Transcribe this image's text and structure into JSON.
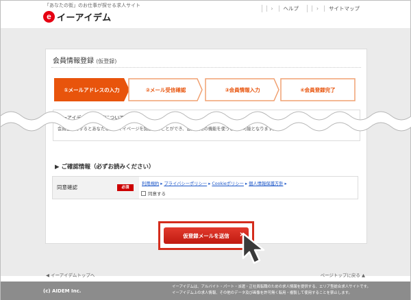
{
  "header": {
    "tagline": "「あなたの街」のお仕事が探せる求人サイト",
    "logo_mark": "e",
    "logo_text": "イーアイデム",
    "util_links": [
      {
        "label": "ヘルプ"
      },
      {
        "label": "サイトマップ"
      }
    ]
  },
  "panel": {
    "title": "会員情報登録",
    "subtitle": "(仮登録)"
  },
  "steps": [
    {
      "label": "①メールアドレスの入力",
      "active": true
    },
    {
      "label": "②メール受信確認",
      "active": false
    },
    {
      "label": "③会員情報入力",
      "active": false
    },
    {
      "label": "④会員登録完了",
      "active": false
    }
  ],
  "info": {
    "title": "イーアイデム会員登録について",
    "text": "会員登録をするとあなた専用のマイページを開設することができ、会員専用の機能を使うことが可能となります。"
  },
  "notice": {
    "title": "▶ ご確認情報（必ずお読みください）"
  },
  "agree": {
    "label": "同意確認",
    "required": "必須",
    "links": [
      "利用規約",
      "プライバシーポリシー",
      "Cookieポリシー",
      "個人情報保護方針"
    ],
    "checkbox_label": "同意する",
    "checked": false
  },
  "submit": {
    "label": "仮登録メールを送信",
    "arrow": "›"
  },
  "bottom_nav": {
    "left": "◀ イーアイデムトップへ",
    "right": "ページトップに戻る ▲"
  },
  "footer": {
    "copyright": "(c) AIDEM Inc.",
    "note_line1": "イーアイデムは、アルバイト・パート・派遣・正社員転職のための求人情報を提供する、エリア型総合求人サイトです。",
    "note_line2": "イーアイデム上の求人情報、その他のデータ及び画像を許可無く転用・複製して使用することを禁止します。"
  },
  "colors": {
    "accent": "#e8540c",
    "step_inactive_border": "#f0a070",
    "step_inactive_text": "#e8540c",
    "submit": "#d42c1c",
    "footer": "#8c8c8c"
  }
}
